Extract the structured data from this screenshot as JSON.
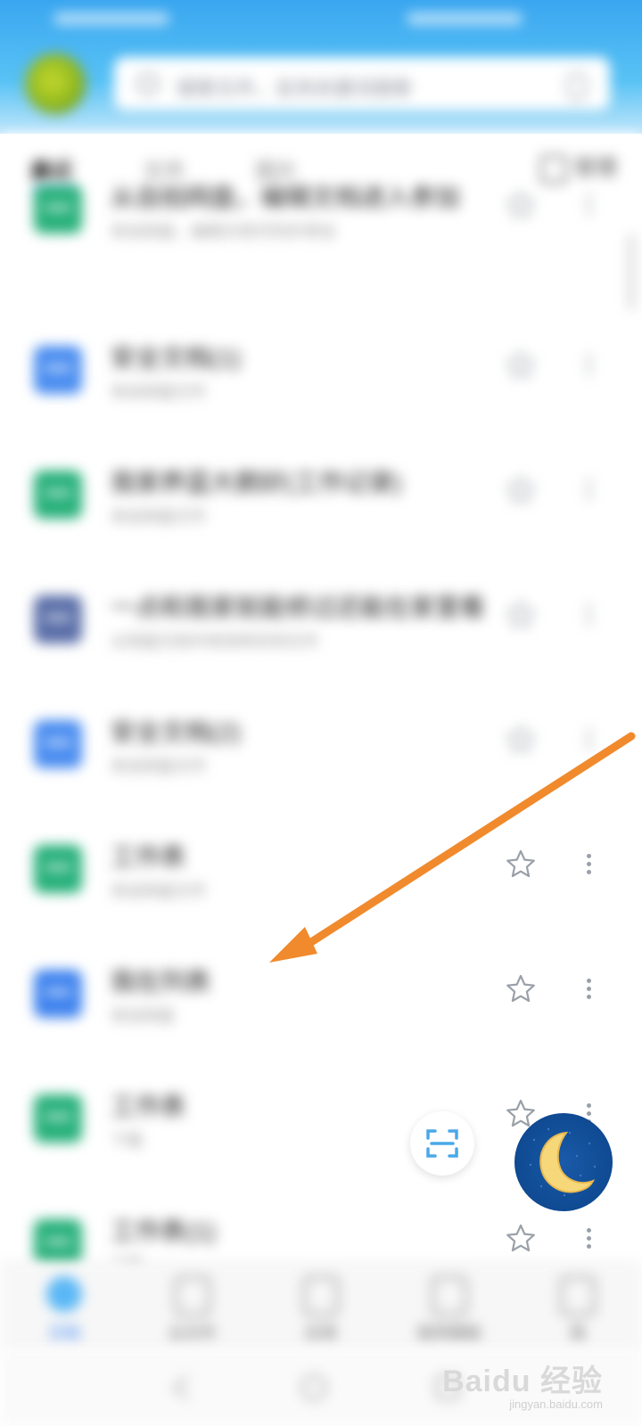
{
  "header": {
    "search_placeholder": "搜索文件，支持关键词搜索"
  },
  "tabs": {
    "items": [
      "最近",
      "文件",
      "图片"
    ],
    "manage_label": "管理"
  },
  "list": [
    {
      "title": "从自拍网盘，编辑文档进入参加",
      "subtitle": "来自网盘，编辑文档可同步参加",
      "color": "#27b07a",
      "starred": false,
      "blurred": true
    },
    {
      "title": "安全文档(1)",
      "subtitle": "来自网盘文件",
      "color": "#4a8df0",
      "starred": false,
      "blurred": true
    },
    {
      "title": "我家养蓝大鹅好(工作记录)",
      "subtitle": "来自网盘文件",
      "color": "#27b07a",
      "starred": false,
      "blurred": true
    },
    {
      "title": "一点和我家就能修过还能在家里看",
      "subtitle": "从网盘文档中修改转存到文件",
      "color": "#5a6ea8",
      "starred": false,
      "blurred": true
    },
    {
      "title": "安全文档(2)",
      "subtitle": "来自网盘文件",
      "color": "#4a8df0",
      "starred": false,
      "blurred": true
    },
    {
      "title": "工作表",
      "subtitle": "来自网盘文件",
      "color": "#27b07a",
      "starred": false,
      "blurred": true
    },
    {
      "title": "我在列表",
      "subtitle": "来自网盘",
      "color": "#3f83ee",
      "starred": false,
      "blurred": true
    },
    {
      "title": "工作表",
      "subtitle": "下载",
      "color": "#27b07a",
      "starred": false,
      "blurred": true
    },
    {
      "title": "工作表(1)",
      "subtitle": "下载",
      "color": "#27b07a",
      "starred": false,
      "blurred": true
    }
  ],
  "bottom_nav": [
    {
      "label": "文档",
      "icon": "documents-icon",
      "active": true
    },
    {
      "label": "云文件",
      "icon": "cloud-files-icon",
      "active": false
    },
    {
      "label": "应用",
      "icon": "apps-icon",
      "active": false
    },
    {
      "label": "稻壳模板",
      "icon": "template-icon",
      "active": false
    },
    {
      "label": "我",
      "icon": "profile-icon",
      "active": false
    }
  ],
  "watermark": {
    "text": "Baidu 经验",
    "url": "jingyan.baidu.com"
  },
  "colors": {
    "accent": "#2b7cf7",
    "annotation_arrow": "#f08a2c",
    "night_button": "#0f4a92",
    "moon": "#f6d77a"
  }
}
